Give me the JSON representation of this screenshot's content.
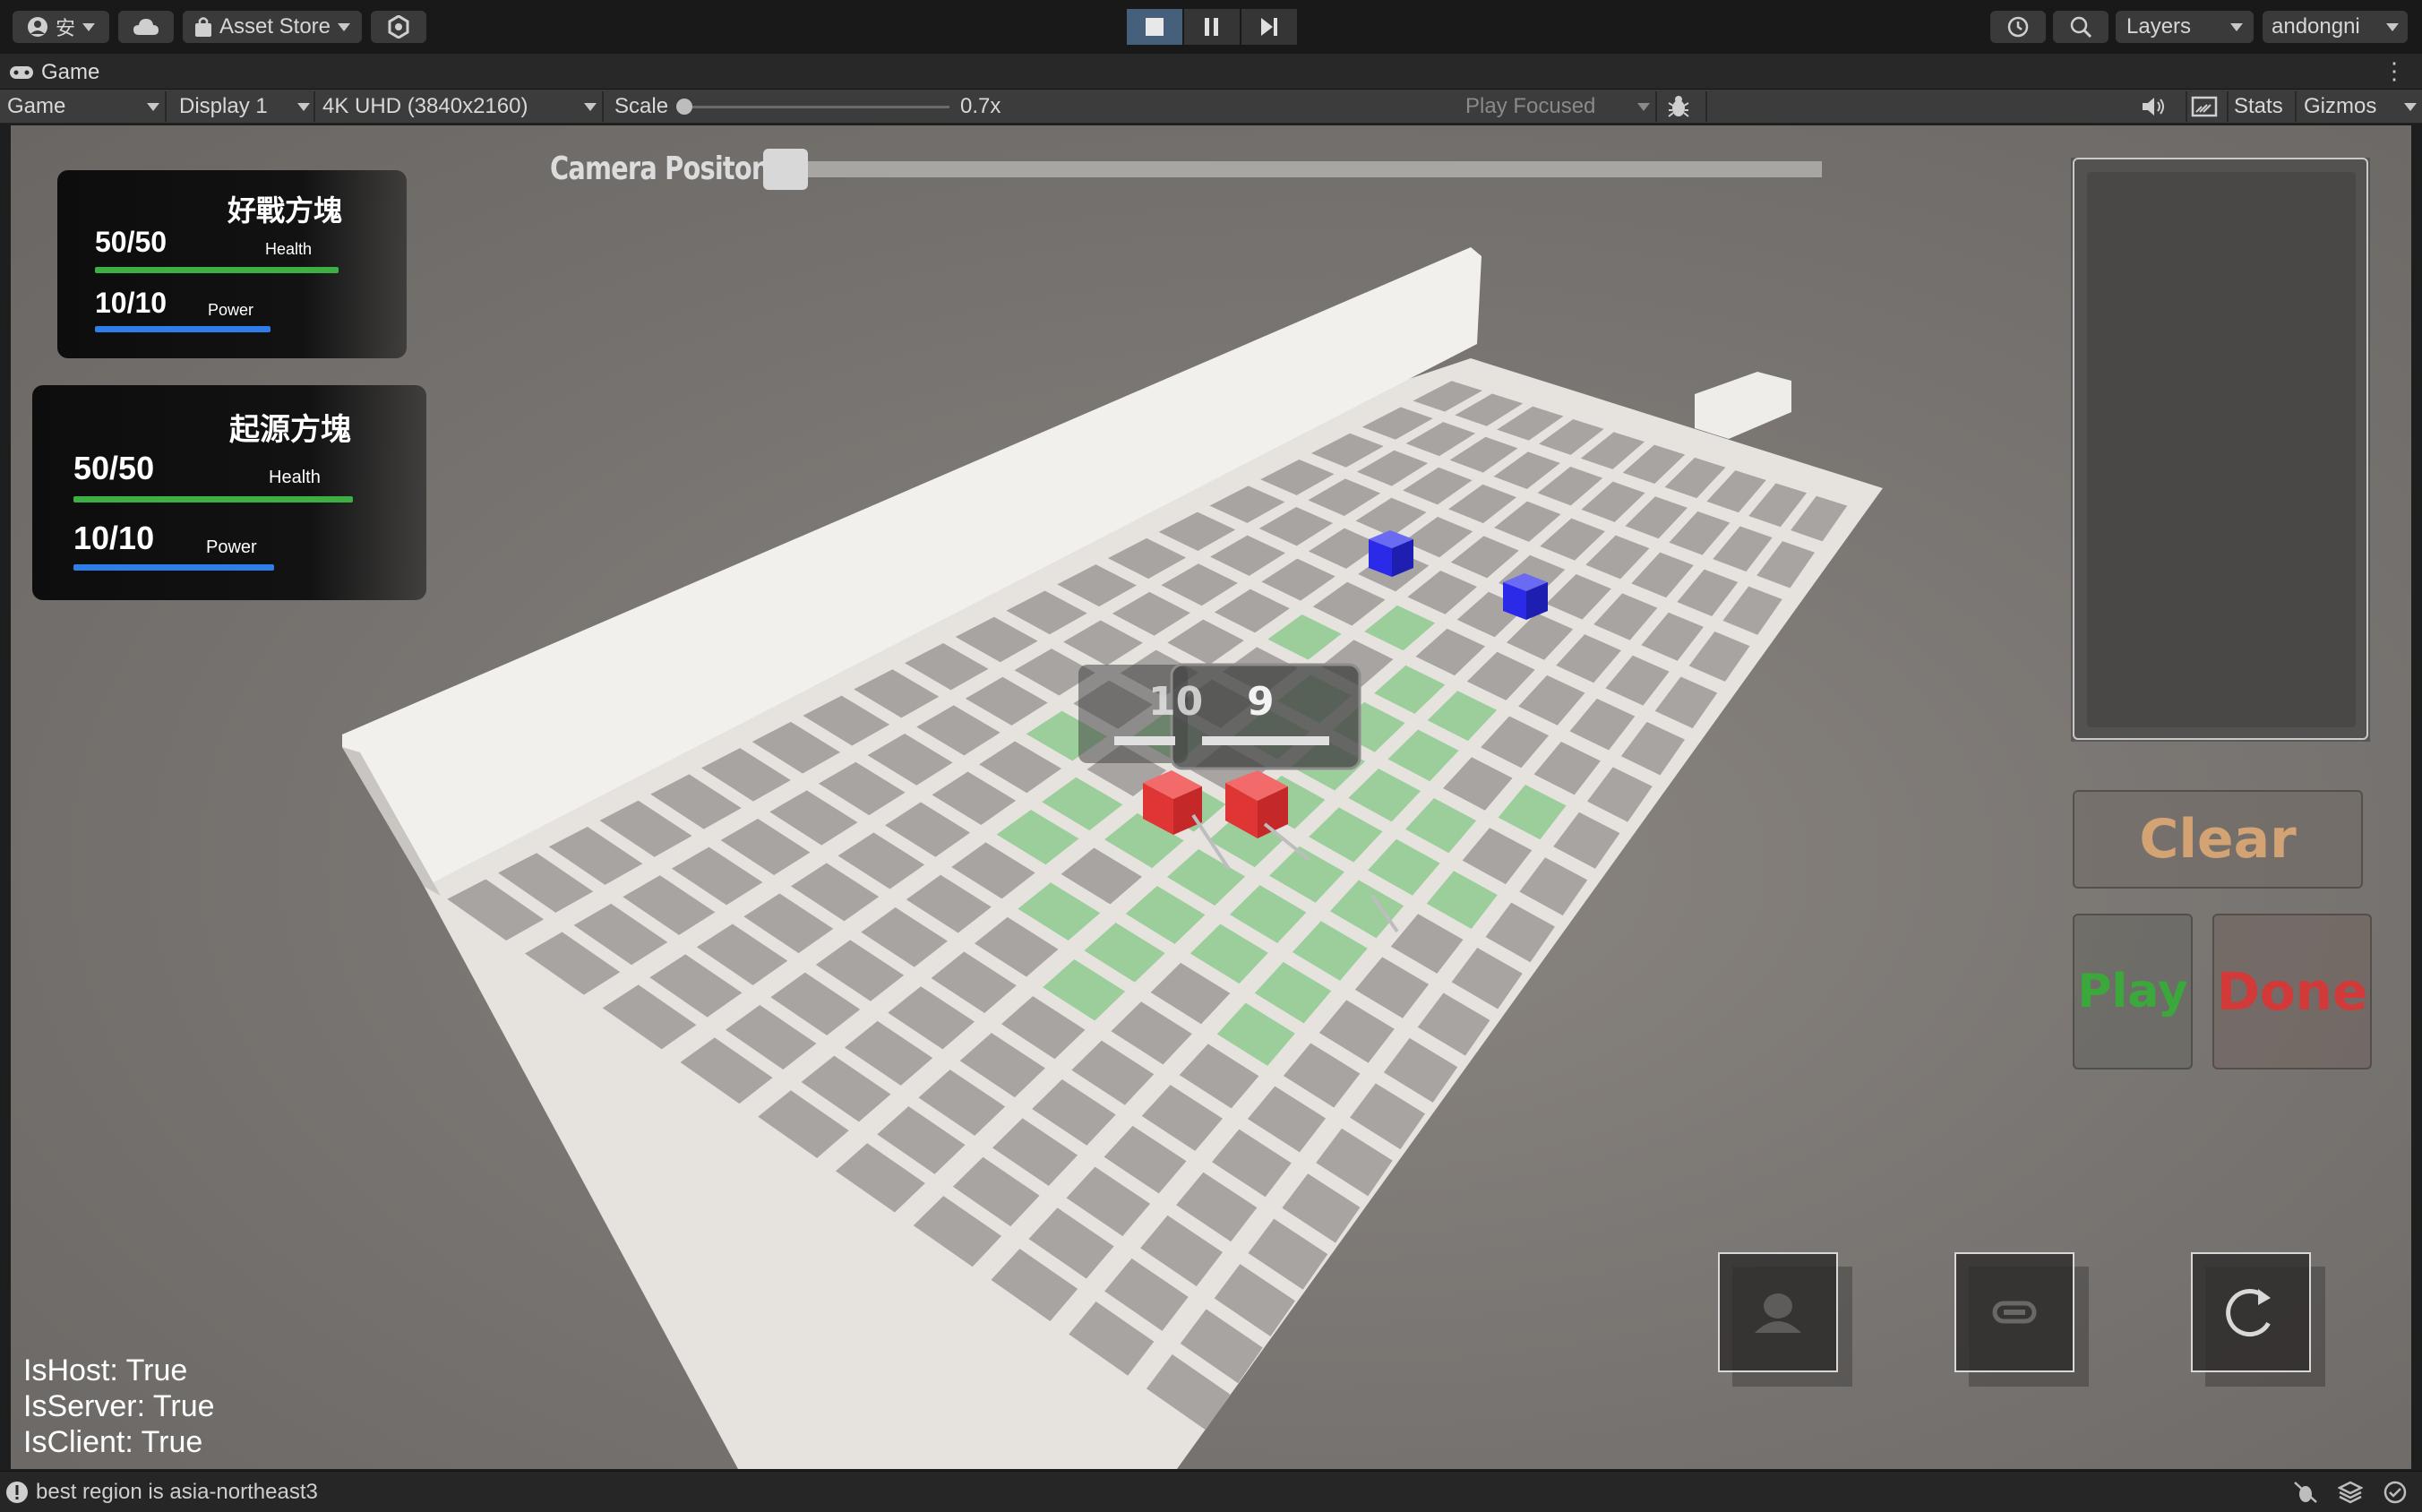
{
  "toolbar": {
    "account_initial": "安",
    "asset_store_label": "Asset Store",
    "layers_label": "Layers",
    "account_name": "andongni"
  },
  "tab": {
    "title": "Game"
  },
  "game_bar": {
    "view_mode": "Game",
    "display": "Display 1",
    "resolution": "4K UHD (3840x2160)",
    "scale_label": "Scale",
    "scale_value": "0.7x",
    "scale_fraction": 0.0,
    "play_mode": "Play Focused",
    "stats_label": "Stats",
    "gizmos_label": "Gizmos"
  },
  "hud": {
    "camera_label": "Camera Positon",
    "camera_slider_fraction": 0.0,
    "player1": {
      "name": "好戰方塊",
      "health": "50/50",
      "health_label": "Health",
      "health_fraction": 1.0,
      "power": "10/10",
      "power_label": "Power",
      "power_fraction": 1.0
    },
    "player2": {
      "name": "起源方塊",
      "health": "50/50",
      "health_label": "Health",
      "health_fraction": 1.0,
      "power": "10/10",
      "power_label": "Power",
      "power_fraction": 1.0
    },
    "unit_counters": [
      "10",
      "9"
    ],
    "clear_label": "Clear",
    "play_label": "Play",
    "done_label": "Done",
    "net_status": [
      "IsHost: True",
      "IsServer: True",
      "IsClient: True"
    ]
  },
  "status": {
    "message": "best region is asia-northeast3"
  },
  "colors": {
    "health_bar": "#3cb043",
    "power_bar": "#2f7de8",
    "selected_tile": "#9cce9c",
    "red_unit": "#e83a3a",
    "blue_unit": "#2a2ae8",
    "clear_text": "#d4a373",
    "play_text": "#3aa83a",
    "done_text": "#d23a3a"
  },
  "icons": {
    "account": "account-icon",
    "cloud": "cloud-icon",
    "asset_store": "bag-icon",
    "settings": "gear-icon",
    "stop": "stop-icon",
    "pause": "pause-icon",
    "step": "step-icon",
    "history": "history-icon",
    "search": "search-icon",
    "bug": "bug-icon",
    "audio": "audio-icon",
    "aspect": "aspect-icon",
    "profile": "profile-icon",
    "link": "link-icon",
    "refresh": "refresh-icon"
  }
}
